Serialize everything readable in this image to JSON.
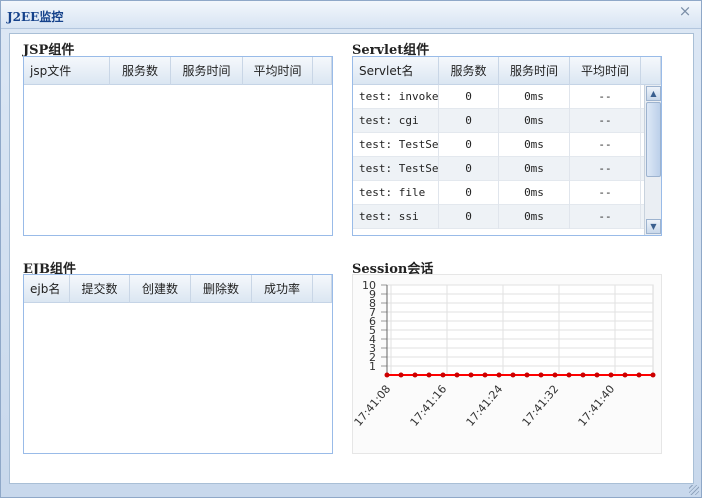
{
  "window": {
    "title": "J2EE监控",
    "close_icon": "×"
  },
  "jsp": {
    "title": "JSP组件",
    "columns": [
      "jsp文件",
      "服务数",
      "服务时间",
      "平均时间"
    ]
  },
  "servlet": {
    "title": "Servlet组件",
    "columns": [
      "Servlet名",
      "服务数",
      "服务时间",
      "平均时间"
    ],
    "rows": [
      {
        "name": "test: invoker",
        "count": "0",
        "time": "0ms",
        "avg": "--"
      },
      {
        "name": "test: cgi",
        "count": "0",
        "time": "0ms",
        "avg": "--"
      },
      {
        "name": "test: TestServ",
        "count": "0",
        "time": "0ms",
        "avg": "--"
      },
      {
        "name": "test: TestServ",
        "count": "0",
        "time": "0ms",
        "avg": "--"
      },
      {
        "name": "test: file",
        "count": "0",
        "time": "0ms",
        "avg": "--"
      },
      {
        "name": "test: ssi",
        "count": "0",
        "time": "0ms",
        "avg": "--"
      }
    ]
  },
  "ejb": {
    "title": "EJB组件",
    "columns": [
      "ejb名",
      "提交数",
      "创建数",
      "删除数",
      "成功率"
    ]
  },
  "session": {
    "title": "Session会话",
    "chart_data": {
      "type": "line",
      "y_ticks": [
        "1",
        "2",
        "3",
        "4",
        "5",
        "6",
        "7",
        "8",
        "9",
        "10"
      ],
      "ylim": [
        0,
        10
      ],
      "x_tick_labels": [
        "17:41:08",
        "17:41:16",
        "17:41:24",
        "17:41:32",
        "17:41:40"
      ],
      "values": [
        0,
        0,
        0,
        0,
        0,
        0,
        0,
        0,
        0,
        0,
        0,
        0,
        0,
        0,
        0,
        0,
        0,
        0,
        0,
        0
      ],
      "line_color": "#ff0000",
      "point_color": "#cc0000",
      "grid": true
    }
  }
}
